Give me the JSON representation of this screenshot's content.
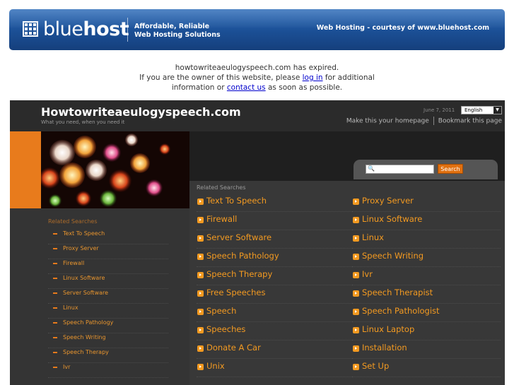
{
  "banner": {
    "logo_regular": "blue",
    "logo_bold": "host",
    "tagline_line1": "Affordable, Reliable",
    "tagline_line2": "Web Hosting Solutions",
    "right_text": "Web Hosting - courtesy of www.bluehost.com",
    "colors": {
      "banner_top": "#2b6ab8",
      "banner_bottom": "#153f7c"
    }
  },
  "expired": {
    "line1": "howtowriteaeulogyspeech.com has expired.",
    "line2_pre": "If you are the owner of this website, please ",
    "login_link": "log in",
    "line2_post": " for additional",
    "line3_pre": "information or ",
    "contact_link": "contact us",
    "line3_post": " as soon as possible."
  },
  "site": {
    "title": "Howtowriteaeulogyspeech.com",
    "subtitle": "What you need, when you need it",
    "date": "June 7, 2011",
    "language": "English",
    "make_homepage": "Make this your homepage",
    "bookmark": "Bookmark this page",
    "search_button": "Search",
    "colors": {
      "accent": "#f39a21",
      "background": "#2f2f2f",
      "orange_bar": "#e87b1c"
    }
  },
  "sidebar": {
    "heading": "Related Searches",
    "items": [
      "Text To Speech",
      "Proxy Server",
      "Firewall",
      "Linux Software",
      "Server Software",
      "Linux",
      "Speech Pathology",
      "Speech Writing",
      "Speech Therapy",
      "Ivr"
    ]
  },
  "main": {
    "heading": "Related Searches",
    "links": [
      "Text To Speech",
      "Proxy Server",
      "Firewall",
      "Linux Software",
      "Server Software",
      "Linux",
      "Speech Pathology",
      "Speech Writing",
      "Speech Therapy",
      "Ivr",
      "Free Speeches",
      "Speech Therapist",
      "Speech",
      "Speech Pathologist",
      "Speeches",
      "Linux Laptop",
      "Donate A Car",
      "Installation",
      "Unix",
      "Set Up"
    ]
  }
}
